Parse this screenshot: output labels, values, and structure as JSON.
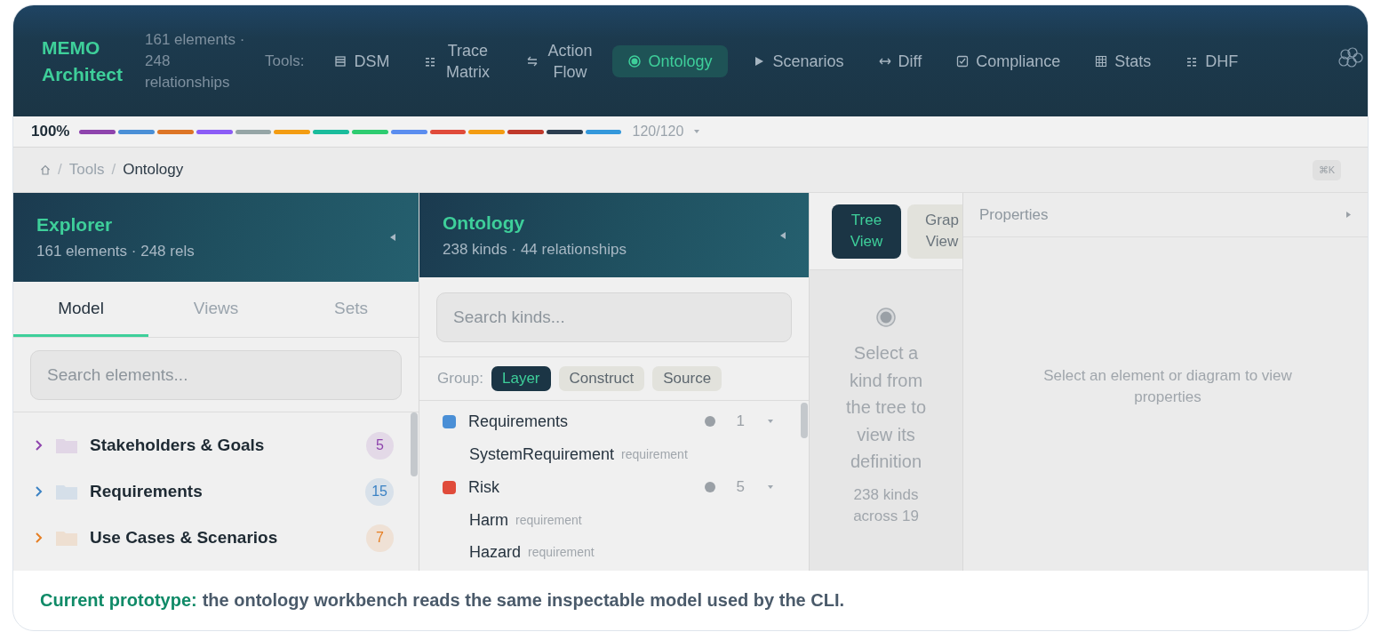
{
  "header": {
    "logo": "MEMO Architect",
    "stats": "161 elements · 248 relationships",
    "tools_label": "Tools:",
    "tools": [
      {
        "kind": "list",
        "label": "DSM",
        "selected": false
      },
      {
        "kind": "dots",
        "label": "Trace Matrix",
        "selected": false
      },
      {
        "kind": "swap",
        "label": "Action Flow",
        "selected": false
      },
      {
        "kind": "target",
        "label": "Ontology",
        "selected": true
      },
      {
        "kind": "play",
        "label": "Scenarios",
        "selected": false
      },
      {
        "kind": "diff",
        "label": "Diff",
        "selected": false
      },
      {
        "kind": "check",
        "label": "Compliance",
        "selected": false
      },
      {
        "kind": "grid",
        "label": "Stats",
        "selected": false
      },
      {
        "kind": "dots",
        "label": "DHF",
        "selected": false
      }
    ]
  },
  "progress": {
    "percent": "100%",
    "count": "120/120",
    "segments": [
      {
        "color": "#8e44ad"
      },
      {
        "color": "#4a8fd6"
      },
      {
        "color": "#dd7526"
      },
      {
        "color": "#8b5cf6"
      },
      {
        "color": "#95a5a6"
      },
      {
        "color": "#f39c12"
      },
      {
        "color": "#1abc9c"
      },
      {
        "color": "#2ecc71"
      },
      {
        "color": "#5b8def"
      },
      {
        "color": "#e04b3a"
      },
      {
        "color": "#f39c12"
      },
      {
        "color": "#c0392b"
      },
      {
        "color": "#2c3e50"
      },
      {
        "color": "#3498db"
      }
    ]
  },
  "breadcrumb": {
    "separator": "/",
    "items": [
      {
        "label": "Tools",
        "selected": false
      },
      {
        "label": "Ontology",
        "selected": true
      }
    ],
    "shortcut": "⌘K"
  },
  "explorer": {
    "title": "Explorer",
    "subtitle": "161 elements · 248 rels",
    "tabs": [
      {
        "label": "Model",
        "selected": true
      },
      {
        "label": "Views",
        "selected": false
      },
      {
        "label": "Sets",
        "selected": false
      }
    ],
    "search": {
      "placeholder": "Search elements..."
    },
    "items": [
      {
        "label": "Stakeholders & Goals",
        "count": "5",
        "color": "#8e44ad"
      },
      {
        "label": "Requirements",
        "count": "15",
        "color": "#3b82c4"
      },
      {
        "label": "Use Cases & Scenarios",
        "count": "7",
        "color": "#e67e22"
      }
    ]
  },
  "ontology": {
    "title": "Ontology",
    "subtitle": "238 kinds · 44 relationships",
    "search": {
      "placeholder": "Search kinds..."
    },
    "group_label": "Group:",
    "group_options": [
      {
        "label": "Layer",
        "selected": true
      },
      {
        "label": "Construct",
        "selected": false
      },
      {
        "label": "Source",
        "selected": false
      }
    ],
    "groups": [
      {
        "name": "Requirements",
        "color": "#4a8fd6",
        "count": "1",
        "children": [
          {
            "name": "SystemRequirement",
            "type": "requirement"
          }
        ]
      },
      {
        "name": "Risk",
        "color": "#e04b3a",
        "count": "5",
        "children": [
          {
            "name": "Harm",
            "type": "requirement"
          },
          {
            "name": "Hazard",
            "type": "requirement"
          }
        ]
      }
    ]
  },
  "viewer": {
    "tabs": [
      {
        "label": "Tree View",
        "selected": true
      },
      {
        "label": "Grap View",
        "selected": false
      }
    ],
    "message": "Select a kind from the tree to view its definition",
    "note": "238 kinds across 19"
  },
  "properties": {
    "title": "Properties",
    "message": "Select an element or diagram to view properties"
  },
  "caption": {
    "lead": "Current prototype:",
    "text": "the ontology workbench reads the same inspectable model used by the CLI."
  }
}
